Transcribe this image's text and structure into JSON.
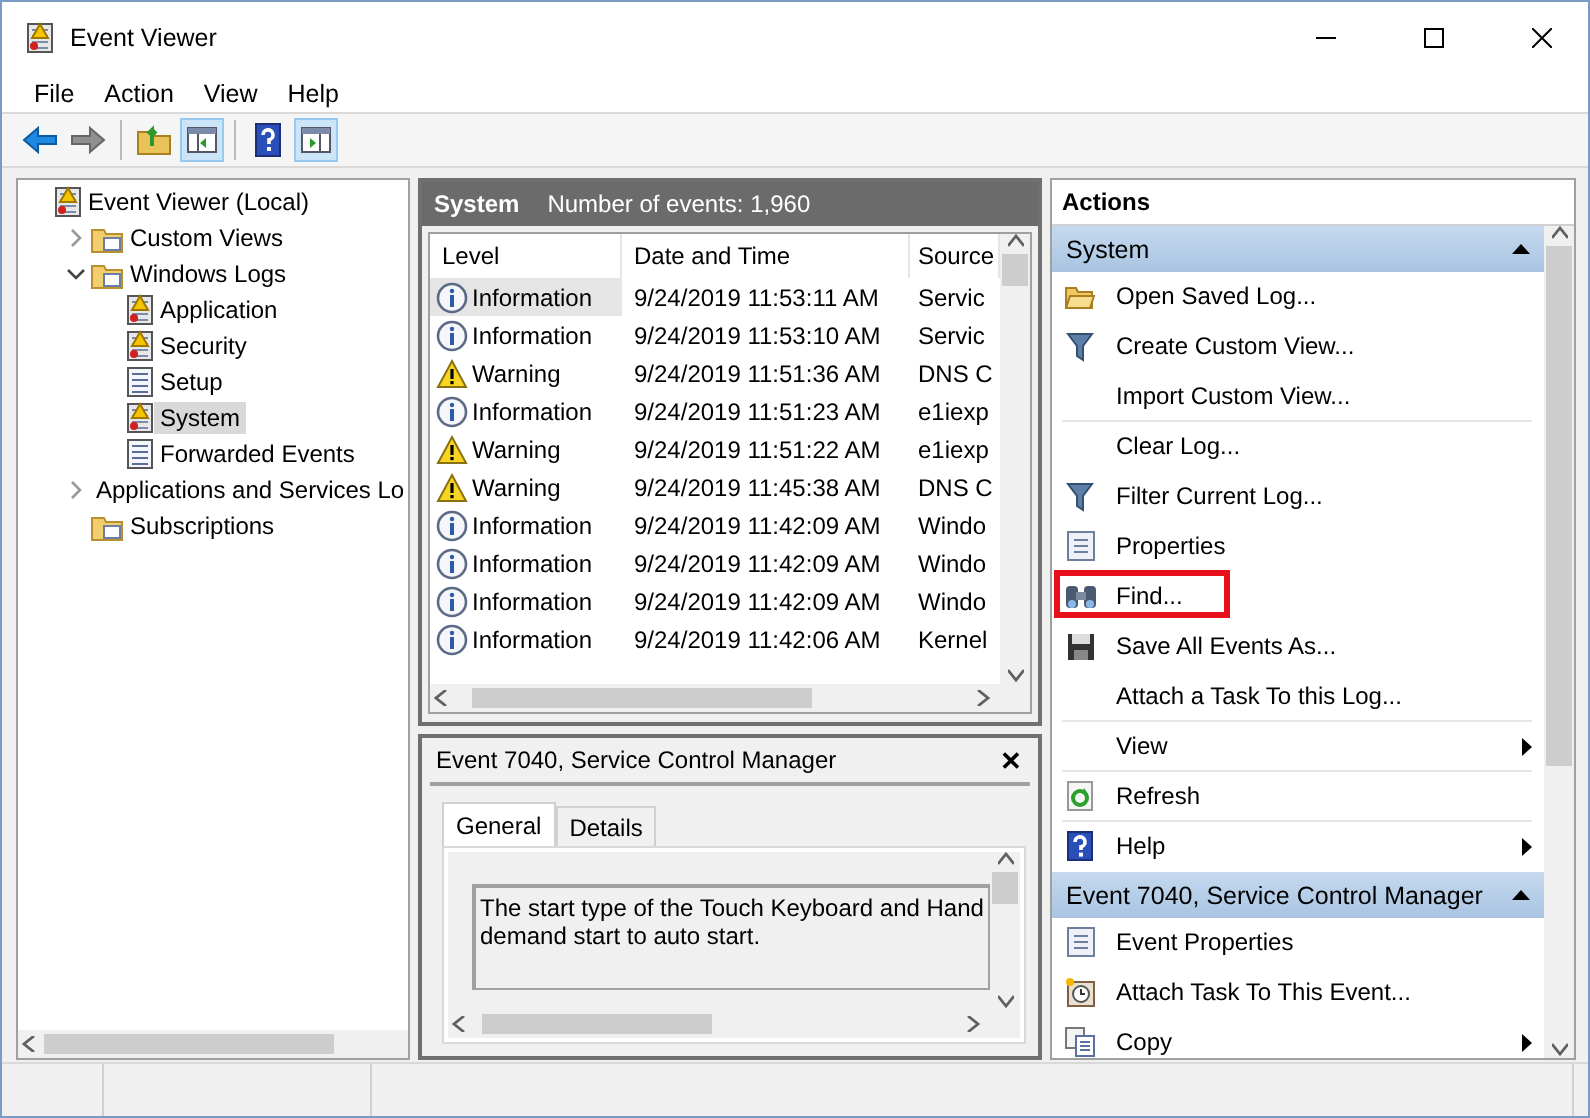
{
  "window": {
    "title": "Event Viewer"
  },
  "menu": [
    "File",
    "Action",
    "View",
    "Help"
  ],
  "toolbar": [
    {
      "kind": "back",
      "pressed": false
    },
    {
      "kind": "forward",
      "pressed": false
    },
    {
      "kind": "up",
      "pressed": false
    },
    {
      "kind": "tree-pane",
      "pressed": true
    },
    {
      "kind": "help",
      "pressed": false
    },
    {
      "kind": "action-pane",
      "pressed": true
    }
  ],
  "tree": [
    {
      "label": "Event Viewer (Local)",
      "kind": "log",
      "selected": false,
      "children": [
        {
          "label": "Custom Views",
          "kind": "folder",
          "selected": false,
          "expanded": false
        },
        {
          "label": "Windows Logs",
          "kind": "folder",
          "selected": false,
          "expanded": true,
          "children": [
            {
              "label": "Application",
              "kind": "log",
              "selected": false
            },
            {
              "label": "Security",
              "kind": "log",
              "selected": false
            },
            {
              "label": "Setup",
              "kind": "page",
              "selected": false
            },
            {
              "label": "System",
              "kind": "log",
              "selected": true
            },
            {
              "label": "Forwarded Events",
              "kind": "page",
              "selected": false
            }
          ]
        },
        {
          "label": "Applications and Services Lo",
          "kind": "folder",
          "selected": false,
          "expanded": false
        },
        {
          "label": "Subscriptions",
          "kind": "folder",
          "selected": false
        }
      ]
    }
  ],
  "log_header": {
    "title": "System",
    "count": "Number of events: 1,960"
  },
  "events": {
    "columns": [
      "Level",
      "Date and Time",
      "Source"
    ],
    "rows": [
      {
        "kind": "info",
        "selected": true,
        "cells": [
          "Information",
          "9/24/2019 11:53:11 AM",
          "Servic"
        ]
      },
      {
        "kind": "info",
        "selected": false,
        "cells": [
          "Information",
          "9/24/2019 11:53:10 AM",
          "Servic"
        ]
      },
      {
        "kind": "warning",
        "selected": false,
        "cells": [
          "Warning",
          "9/24/2019 11:51:36 AM",
          "DNS C"
        ]
      },
      {
        "kind": "info",
        "selected": false,
        "cells": [
          "Information",
          "9/24/2019 11:51:23 AM",
          "e1iexp"
        ]
      },
      {
        "kind": "warning",
        "selected": false,
        "cells": [
          "Warning",
          "9/24/2019 11:51:22 AM",
          "e1iexp"
        ]
      },
      {
        "kind": "warning",
        "selected": false,
        "cells": [
          "Warning",
          "9/24/2019 11:45:38 AM",
          "DNS C"
        ]
      },
      {
        "kind": "info",
        "selected": false,
        "cells": [
          "Information",
          "9/24/2019 11:42:09 AM",
          "Windo"
        ]
      },
      {
        "kind": "info",
        "selected": false,
        "cells": [
          "Information",
          "9/24/2019 11:42:09 AM",
          "Windo"
        ]
      },
      {
        "kind": "info",
        "selected": false,
        "cells": [
          "Information",
          "9/24/2019 11:42:09 AM",
          "Windo"
        ]
      },
      {
        "kind": "info",
        "selected": false,
        "cells": [
          "Information",
          "9/24/2019 11:42:06 AM",
          "Kernel"
        ]
      }
    ]
  },
  "detail": {
    "title": "Event 7040, Service Control Manager",
    "close": "✕",
    "tabs": [
      {
        "label": "General",
        "selected": true
      },
      {
        "label": "Details",
        "selected": false
      }
    ],
    "lines": [
      "The start type of the Touch Keyboard and Hand",
      "demand start to auto start."
    ]
  },
  "actions": {
    "title": "Actions",
    "sections": [
      {
        "title": "System",
        "items": [
          {
            "kind": "open",
            "label": "Open Saved Log...",
            "submenu": false,
            "divider": false,
            "highlighted": false
          },
          {
            "kind": "filter",
            "label": "Create Custom View...",
            "submenu": false,
            "divider": false,
            "highlighted": false
          },
          {
            "kind": "none",
            "label": "Import Custom View...",
            "submenu": false,
            "divider": true,
            "highlighted": false
          },
          {
            "kind": "none",
            "label": "Clear Log...",
            "submenu": false,
            "divider": false,
            "highlighted": false
          },
          {
            "kind": "filter",
            "label": "Filter Current Log...",
            "submenu": false,
            "divider": false,
            "highlighted": false
          },
          {
            "kind": "properties",
            "label": "Properties",
            "submenu": false,
            "divider": false,
            "highlighted": false
          },
          {
            "kind": "find",
            "label": "Find...",
            "submenu": false,
            "divider": false,
            "highlighted": true
          },
          {
            "kind": "save",
            "label": "Save All Events As...",
            "submenu": false,
            "divider": false,
            "highlighted": false
          },
          {
            "kind": "none",
            "label": "Attach a Task To this Log...",
            "submenu": false,
            "divider": true,
            "highlighted": false
          },
          {
            "kind": "none",
            "label": "View",
            "submenu": true,
            "divider": true,
            "highlighted": false
          },
          {
            "kind": "refresh",
            "label": "Refresh",
            "submenu": false,
            "divider": true,
            "highlighted": false
          },
          {
            "kind": "help",
            "label": "Help",
            "submenu": true,
            "divider": false,
            "highlighted": false
          }
        ]
      },
      {
        "title": "Event 7040, Service Control Manager",
        "items": [
          {
            "kind": "properties",
            "label": "Event Properties",
            "submenu": false,
            "divider": false,
            "highlighted": false
          },
          {
            "kind": "task",
            "label": "Attach Task To This Event...",
            "submenu": false,
            "divider": false,
            "highlighted": false
          },
          {
            "kind": "copy",
            "label": "Copy",
            "submenu": true,
            "divider": false,
            "highlighted": false
          }
        ]
      }
    ]
  }
}
